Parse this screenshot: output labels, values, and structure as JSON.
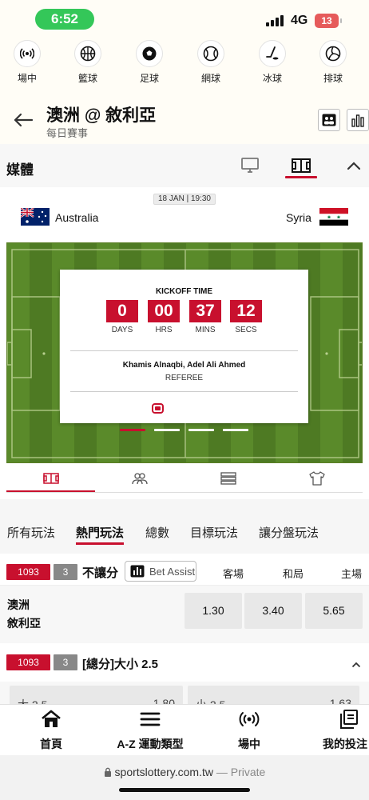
{
  "status_bar": {
    "time": "6:52",
    "network": "4G",
    "battery": "13"
  },
  "sports": [
    {
      "label": "場中",
      "icon": "live-broadcast-icon"
    },
    {
      "label": "籃球",
      "icon": "basketball-icon"
    },
    {
      "label": "足球",
      "icon": "soccer-ball-icon"
    },
    {
      "label": "網球",
      "icon": "tennis-ball-icon"
    },
    {
      "label": "冰球",
      "icon": "ice-hockey-icon"
    },
    {
      "label": "排球",
      "icon": "volleyball-icon"
    }
  ],
  "header": {
    "title": "澳洲 @ 敘利亞",
    "subtitle": "每日賽事"
  },
  "media": {
    "label": "媒體"
  },
  "match": {
    "date": "18 JAN | 19:30",
    "home_team": "Australia",
    "away_team": "Syria",
    "countdown": {
      "title": "KICKOFF TIME",
      "days": "0",
      "hours": "00",
      "mins": "37",
      "secs": "12",
      "days_label": "DAYS",
      "hours_label": "HRS",
      "mins_label": "MINS",
      "secs_label": "SECS",
      "referee_name": "Khamis Alnaqbi, Adel Ali Ahmed",
      "referee_label": "REFEREE"
    }
  },
  "market_tabs": [
    "所有玩法",
    "熱門玩法",
    "總數",
    "目標玩法",
    "讓分盤玩法"
  ],
  "sections": [
    {
      "id": "1093",
      "count": "3",
      "name": "不讓分",
      "bet_assist": "Bet Assist",
      "columns": [
        "客場",
        "和局",
        "主場"
      ],
      "teams": [
        "澳洲",
        "敘利亞"
      ],
      "odds": [
        "1.30",
        "3.40",
        "5.65"
      ]
    },
    {
      "id": "1093",
      "count": "3",
      "name": "[總分]大小 2.5",
      "partial": [
        "大 2.5",
        "1.80",
        "小 2.5",
        "1.63"
      ]
    }
  ],
  "bottom_nav": [
    {
      "label": "首頁",
      "icon": "home-icon"
    },
    {
      "label": "A-Z 運動類型",
      "icon": "menu-icon"
    },
    {
      "label": "場中",
      "icon": "live-broadcast-icon"
    },
    {
      "label": "我的投注",
      "icon": "bet-slip-icon"
    }
  ],
  "browser": {
    "domain": "sportslottery.com.tw",
    "mode": "— Private"
  },
  "colors": {
    "accent": "#c8102e",
    "pitch": "#4e7a23"
  }
}
